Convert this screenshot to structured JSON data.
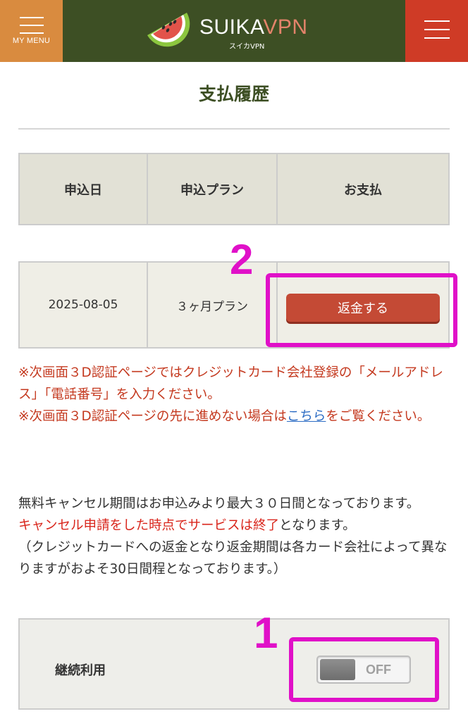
{
  "header": {
    "left_menu_label": "MY MENU",
    "logo_text_main": "SUIKA",
    "logo_text_accent": "VPN",
    "logo_sub": "スイカVPN",
    "colors": {
      "bar": "#3d4f24",
      "left_button": "#d98b3f",
      "right_button": "#cf3b26"
    }
  },
  "page": {
    "title": "支払履歴"
  },
  "table": {
    "headers": [
      "申込日",
      "申込プラン",
      "お支払"
    ],
    "rows": [
      {
        "date": "2025-08-05",
        "plan": "３ヶ月プラン",
        "action": "返金する"
      }
    ]
  },
  "notes": {
    "line1": "※次画面３D認証ページではクレジットカード会社登録の「メールアドレス」「電話番号」を入力ください。",
    "line2_before": "※次画面３D認証ページの先に進めない場合は",
    "line2_link": "こちら",
    "line2_after": "をご覧ください。"
  },
  "info": {
    "line1": "無料キャンセル期間はお申込みより最大３０日間となっております。",
    "line2_red": "キャンセル申請をした時点でサービスは終了",
    "line2_rest": "となります。",
    "line3": "（クレジットカードへの返金となり返金期間は各カード会社によって異なりますがおよそ30日間程となっております。）"
  },
  "continue": {
    "label": "継続利用",
    "toggle_state": "OFF"
  },
  "annotations": {
    "num1": "1",
    "num2": "2",
    "color": "#e010c8"
  }
}
